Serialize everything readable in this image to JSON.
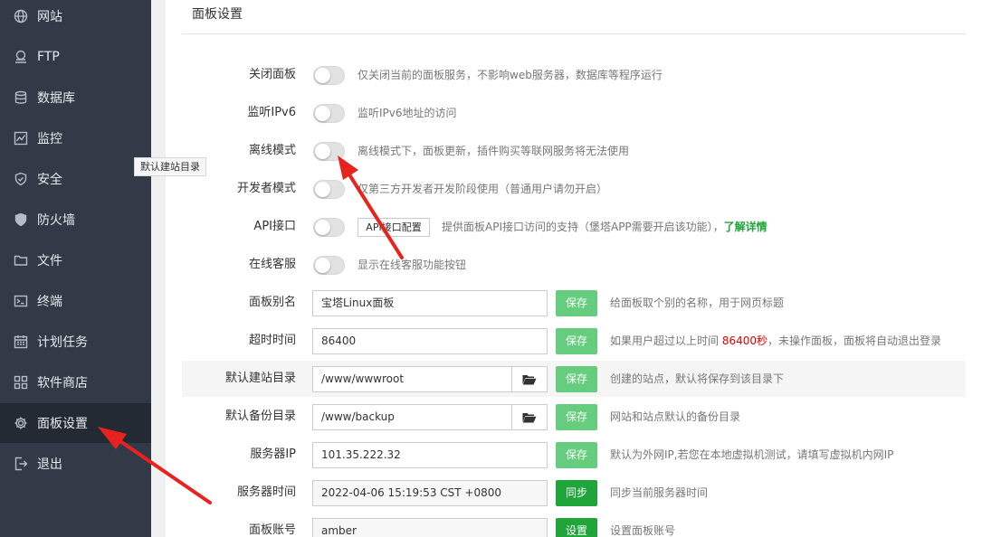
{
  "sidebar": {
    "items": [
      {
        "label": "网站",
        "icon": "globe-icon"
      },
      {
        "label": "FTP",
        "icon": "ftp-icon"
      },
      {
        "label": "数据库",
        "icon": "database-icon"
      },
      {
        "label": "监控",
        "icon": "monitor-icon"
      },
      {
        "label": "安全",
        "icon": "shield-icon"
      },
      {
        "label": "防火墙",
        "icon": "firewall-icon"
      },
      {
        "label": "文件",
        "icon": "folder-icon"
      },
      {
        "label": "终端",
        "icon": "terminal-icon"
      },
      {
        "label": "计划任务",
        "icon": "calendar-icon"
      },
      {
        "label": "软件商店",
        "icon": "apps-grid-icon"
      },
      {
        "label": "面板设置",
        "icon": "gear-icon"
      },
      {
        "label": "退出",
        "icon": "logout-icon"
      }
    ],
    "active": "面板设置",
    "tooltip": "默认建站目录"
  },
  "main": {
    "title": "面板设置",
    "toggles": [
      {
        "label": "关闭面板",
        "desc": "仅关闭当前的面板服务，不影响web服务器，数据库等程序运行",
        "on": false
      },
      {
        "label": "监听IPv6",
        "desc": "监听IPv6地址的访问",
        "on": false
      },
      {
        "label": "离线模式",
        "desc": "离线模式下，面板更新，插件购买等联网服务将无法使用",
        "on": false
      },
      {
        "label": "开发者模式",
        "desc": "仅第三方开发者开发阶段使用（普通用户请勿开启）",
        "on": false
      },
      {
        "label": "API接口",
        "button": "API接口配置",
        "desc": "提供面板API接口访问的支持（堡塔APP需要开启该功能），",
        "link": "了解详情",
        "on": false
      },
      {
        "label": "在线客服",
        "desc": "显示在线客服功能按钮",
        "on": false
      }
    ],
    "fields": [
      {
        "label": "面板别名",
        "value": "宝塔Linux面板",
        "button": "保存",
        "desc": "给面板取个别的名称，用于网页标题"
      },
      {
        "label": "超时时间",
        "value": "86400",
        "button": "保存",
        "desc_before": "如果用户超过以上时间 ",
        "desc_highlight": "86400秒",
        "desc_after": "，未操作面板，面板将自动退出登录"
      },
      {
        "label": "默认建站目录",
        "value": "/www/wwwroot",
        "button": "保存",
        "desc": "创建的站点，默认将保存到该目录下"
      },
      {
        "label": "默认备份目录",
        "value": "/www/backup",
        "button": "保存",
        "desc": "网站和站点默认的备份目录"
      },
      {
        "label": "服务器IP",
        "value": "101.35.222.32",
        "button": "保存",
        "desc": "默认为外网IP,若您在本地虚拟机测试，请填写虚拟机内网IP"
      },
      {
        "label": "服务器时间",
        "value": "2022-04-06 15:19:53 CST +0800",
        "button": "同步",
        "desc": "同步当前服务器时间"
      },
      {
        "label": "面板账号",
        "value": "amber",
        "button": "设置",
        "desc": "设置面板账号"
      }
    ]
  },
  "colors": {
    "sidebar_bg": "#313a46",
    "sidebar_active": "#232a33",
    "accent_green": "#20a53a",
    "light_green": "#65cd7d",
    "highlight_red": "#d00",
    "annotation_arrow": "#e8231f"
  }
}
